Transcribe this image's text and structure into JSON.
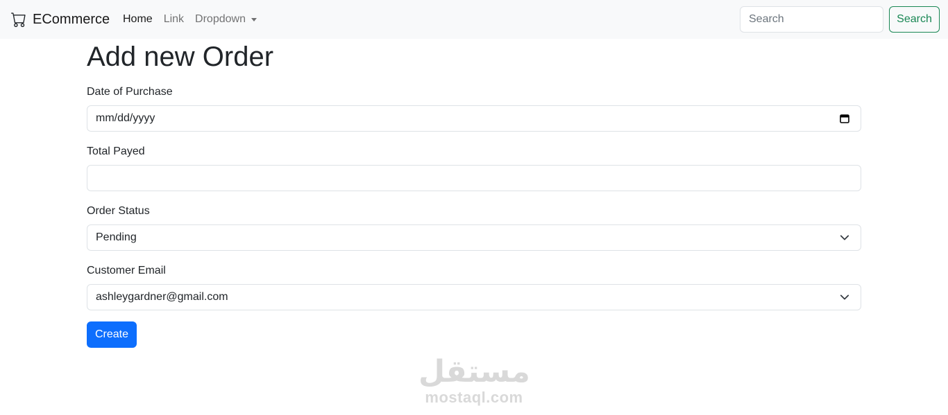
{
  "navbar": {
    "brand": "ECommerce",
    "brand_icon": "cart-icon",
    "links": [
      {
        "label": "Home",
        "active": true
      },
      {
        "label": "Link",
        "active": false
      },
      {
        "label": "Dropdown",
        "active": false,
        "dropdown": true
      }
    ],
    "search": {
      "placeholder": "Search",
      "value": ""
    },
    "search_button": "Search"
  },
  "form": {
    "title": "Add new Order",
    "fields": {
      "date": {
        "label": "Date of Purchase",
        "value": "mm/dd/yyyy",
        "icon": "calendar-icon"
      },
      "total": {
        "label": "Total Payed",
        "value": ""
      },
      "status": {
        "label": "Order Status",
        "value": "Pending",
        "icon": "chevron-down-icon"
      },
      "email": {
        "label": "Customer Email",
        "value": "ashleygardner@gmail.com",
        "icon": "chevron-down-icon"
      }
    },
    "submit_label": "Create"
  },
  "watermark": {
    "arabic": "مستقل",
    "latin": "mostaql.com"
  },
  "colors": {
    "navbar_bg": "#f8f9fa",
    "primary": "#0d6efd",
    "success": "#198754",
    "border": "#dee2e6"
  }
}
